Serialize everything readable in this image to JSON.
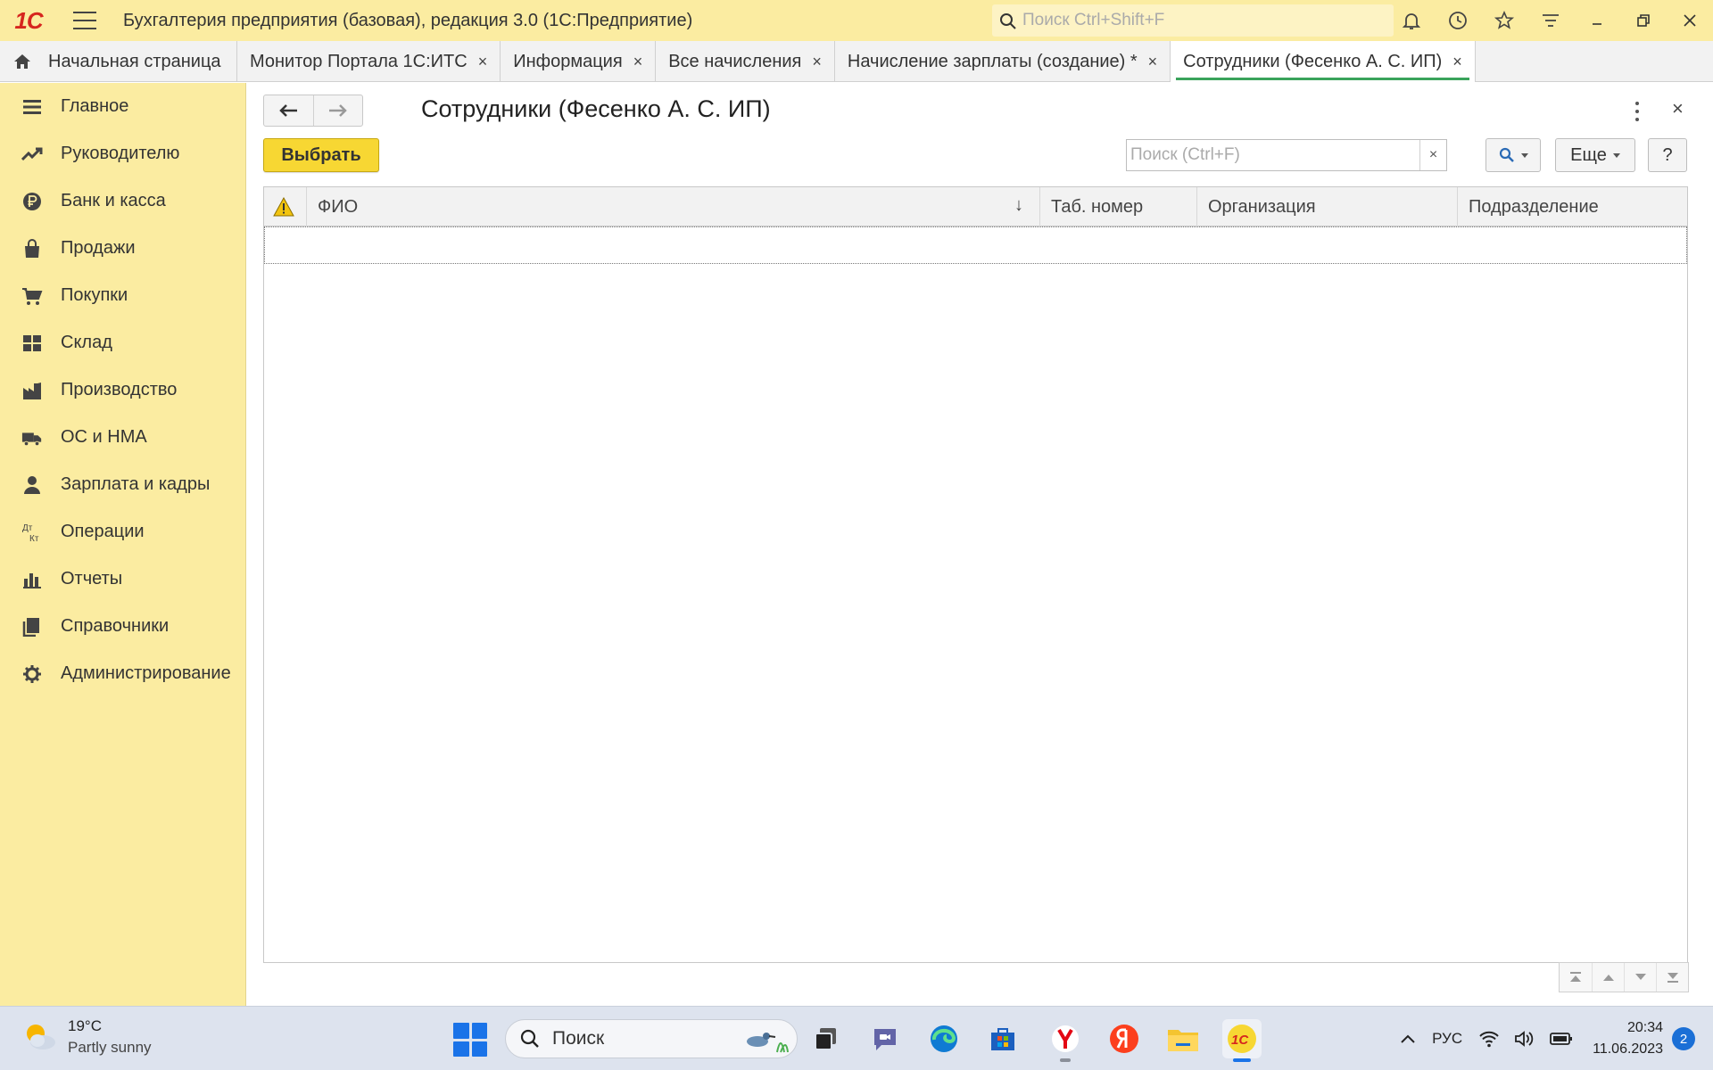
{
  "titlebar": {
    "logo": "1С",
    "title": "Бухгалтерия предприятия (базовая), редакция 3.0  (1С:Предприятие)",
    "search_placeholder": "Поиск Ctrl+Shift+F"
  },
  "tabs": [
    {
      "label": "Начальная страница"
    },
    {
      "label": "Монитор Портала 1С:ИТС"
    },
    {
      "label": "Информация"
    },
    {
      "label": "Все начисления"
    },
    {
      "label": "Начисление зарплаты (создание) *"
    },
    {
      "label": "Сотрудники (Фесенко А. С. ИП)"
    }
  ],
  "tab_close_glyph": "×",
  "sidebar": {
    "items": [
      {
        "label": "Главное",
        "icon": "menu-list-icon"
      },
      {
        "label": "Руководителю",
        "icon": "trend-chart-icon"
      },
      {
        "label": "Банк и касса",
        "icon": "ruble-coin-icon"
      },
      {
        "label": "Продажи",
        "icon": "shopping-bag-icon"
      },
      {
        "label": "Покупки",
        "icon": "cart-icon"
      },
      {
        "label": "Склад",
        "icon": "warehouse-grid-icon"
      },
      {
        "label": "Производство",
        "icon": "factory-icon"
      },
      {
        "label": "ОС и НМА",
        "icon": "truck-icon"
      },
      {
        "label": "Зарплата и кадры",
        "icon": "person-icon"
      },
      {
        "label": "Операции",
        "icon": "debit-credit-icon"
      },
      {
        "label": "Отчеты",
        "icon": "bar-chart-icon"
      },
      {
        "label": "Справочники",
        "icon": "books-icon"
      },
      {
        "label": "Администрирование",
        "icon": "gear-icon"
      }
    ]
  },
  "form": {
    "title": "Сотрудники (Фесенко А. С. ИП)",
    "select_label": "Выбрать",
    "search_placeholder": "Поиск (Ctrl+F)",
    "search_clear": "×",
    "more_label": "Еще",
    "help_label": "?",
    "close_glyph": "×",
    "columns": {
      "fio": "ФИО",
      "sort_glyph": "↓",
      "tab_number": "Таб. номер",
      "organization": "Организация",
      "department": "Подразделение"
    }
  },
  "taskbar": {
    "weather_temp": "19°C",
    "weather_cond": "Partly sunny",
    "search_label": "Поиск",
    "lang": "РУС",
    "time": "20:34",
    "date": "11.06.2023",
    "notifications": "2"
  },
  "colors": {
    "panel_yellow": "#fbeca1",
    "button_yellow": "#f7d733",
    "active_tab_underline": "#3aa35b",
    "brand_red": "#d6261e"
  }
}
